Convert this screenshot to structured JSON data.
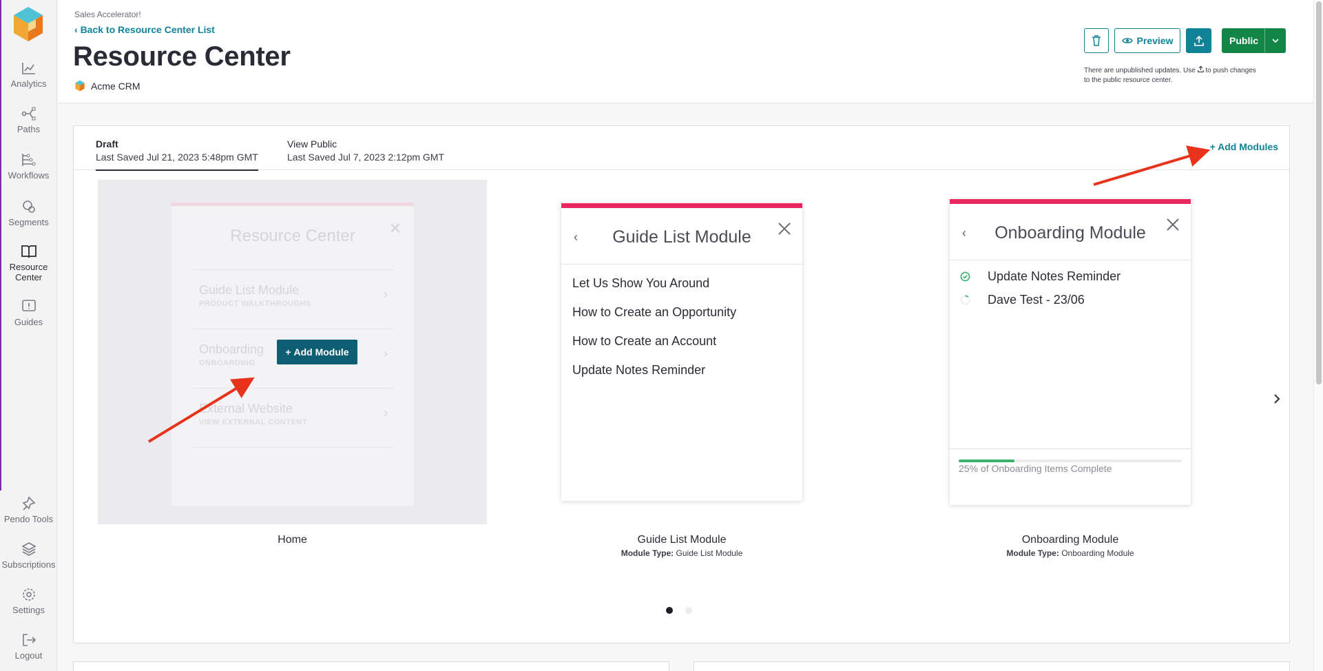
{
  "sidebar": {
    "items": [
      {
        "label": "Analytics",
        "icon": "analytics-icon"
      },
      {
        "label": "Paths",
        "icon": "paths-icon"
      },
      {
        "label": "Workflows",
        "icon": "workflows-icon"
      },
      {
        "label": "Segments",
        "icon": "segments-icon"
      },
      {
        "label": "Resource Center",
        "icon": "book-icon"
      },
      {
        "label": "Guides",
        "icon": "guides-icon"
      }
    ],
    "bottom_items": [
      {
        "label": "Pendo Tools",
        "icon": "pendo-tools-icon"
      },
      {
        "label": "Subscriptions",
        "icon": "layers-icon"
      },
      {
        "label": "Settings",
        "icon": "gear-icon"
      },
      {
        "label": "Logout",
        "icon": "logout-icon"
      }
    ]
  },
  "header": {
    "app_name": "Sales Accelerator!",
    "back_link": "Back to Resource Center List",
    "title": "Resource Center",
    "app_tag": "Acme CRM",
    "preview_label": "Preview",
    "public_label": "Public",
    "notice_part1": "There are unpublished updates. Use",
    "notice_part2": "to push changes to the public resource center."
  },
  "tabs": {
    "draft_title": "Draft",
    "draft_saved": "Last Saved Jul 21, 2023 5:48pm GMT",
    "public_title": "View Public",
    "public_saved": "Last Saved Jul 7, 2023 2:12pm GMT"
  },
  "add_modules_label": "Add Modules",
  "home_preview": {
    "ghost_title": "Resource Center",
    "rows": [
      {
        "title": "Guide List Module",
        "sub": "PRODUCT WALKTHROUGHS"
      },
      {
        "title": "Onboarding",
        "sub": "ONBOARDING"
      },
      {
        "title": "External Website",
        "sub": "VIEW EXTERNAL CONTENT"
      }
    ],
    "add_module_label": "Add Module",
    "caption": "Home"
  },
  "guide_module": {
    "title": "Guide List Module",
    "items": [
      "Let Us Show You Around",
      "How to Create an Opportunity",
      "How to Create an Account",
      "Update Notes Reminder"
    ],
    "caption": "Guide List Module",
    "type_label": "Module Type:",
    "type_value": "Guide List Module"
  },
  "onboarding_module": {
    "title": "Onboarding Module",
    "items": [
      {
        "label": "Update Notes Reminder",
        "status": "complete"
      },
      {
        "label": "Dave Test - 23/06",
        "status": "in-progress"
      }
    ],
    "progress_fraction": 0.25,
    "progress_text": "25% of Onboarding Items Complete",
    "caption": "Onboarding Module",
    "type_label": "Module Type:",
    "type_value": "Onboarding Module"
  },
  "carousel": {
    "pages": 2,
    "current": 1
  },
  "colors": {
    "accent_teal": "#128297",
    "publish_green": "#138547",
    "module_bar": "#e8285e",
    "arrow_red": "#e8331c"
  }
}
